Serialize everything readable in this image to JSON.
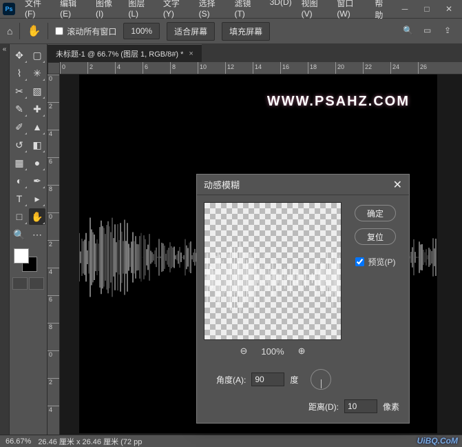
{
  "menu": {
    "file": "文件(F)",
    "edit": "编辑(E)",
    "image": "图像(I)",
    "layer": "图层(L)",
    "type": "文字(Y)",
    "select": "选择(S)",
    "filter": "滤镜(T)",
    "threeD": "3D(D)",
    "view": "视图(V)",
    "window": "窗口(W)",
    "help": "帮助"
  },
  "options": {
    "scroll_all_windows": "滚动所有窗口",
    "zoom": "100%",
    "fit_screen": "适合屏幕",
    "fill_screen": "填充屏幕"
  },
  "doc": {
    "tab_title": "未标题-1 @ 66.7% (图层 1, RGB/8#) *"
  },
  "ruler_h": [
    "0",
    "2",
    "4",
    "6",
    "8",
    "10",
    "12",
    "14",
    "16",
    "18",
    "20",
    "22",
    "24",
    "26"
  ],
  "ruler_v": [
    "0",
    "2",
    "4",
    "6",
    "8",
    "0",
    "2",
    "4",
    "6",
    "8",
    "0",
    "2",
    "4"
  ],
  "canvas": {
    "watermark": "WWW.PSAHZ.COM"
  },
  "dialog": {
    "title": "动感模糊",
    "ok": "确定",
    "reset": "复位",
    "preview_label": "预览(P)",
    "preview_checked": true,
    "zoom": "100%",
    "angle_label": "角度(A):",
    "angle_value": "90",
    "angle_unit": "度",
    "distance_label": "距离(D):",
    "distance_value": "10",
    "distance_unit": "像素"
  },
  "status": {
    "zoom": "66.67%",
    "dims": "26.46 厘米 x 26.46 厘米 (72 pp"
  },
  "brand": "UiBQ.CoM"
}
